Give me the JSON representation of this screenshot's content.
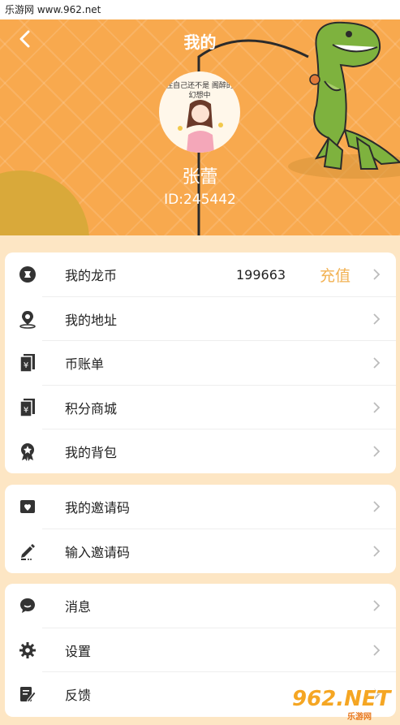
{
  "watermark": {
    "top_text": "乐游网 www.962.net",
    "bottom_big": "962.NET",
    "bottom_small": "乐游网"
  },
  "header": {
    "title": "我的",
    "avatar_caption": "住自己还不是 阁醉的幻想中",
    "username": "张蕾",
    "user_id": "ID:245442"
  },
  "section1": {
    "items": [
      {
        "label": "我的龙币",
        "icon": "coin-icon",
        "value": "199663",
        "action": "充值"
      },
      {
        "label": "我的地址",
        "icon": "location-pin-icon"
      },
      {
        "label": "币账单",
        "icon": "bill-icon"
      },
      {
        "label": "积分商城",
        "icon": "points-mall-icon"
      },
      {
        "label": "我的背包",
        "icon": "badge-icon"
      }
    ]
  },
  "section2": {
    "items": [
      {
        "label": "我的邀请码",
        "icon": "invite-icon"
      },
      {
        "label": "输入邀请码",
        "icon": "pencil-icon"
      }
    ]
  },
  "section3": {
    "items": [
      {
        "label": "消息",
        "icon": "message-icon"
      },
      {
        "label": "设置",
        "icon": "gear-icon"
      },
      {
        "label": "反馈",
        "icon": "feedback-icon"
      }
    ]
  },
  "colors": {
    "header_bg": "#f8a94e",
    "accent": "#f2b253",
    "page_bg": "#fde6c4",
    "icon": "#333333"
  }
}
